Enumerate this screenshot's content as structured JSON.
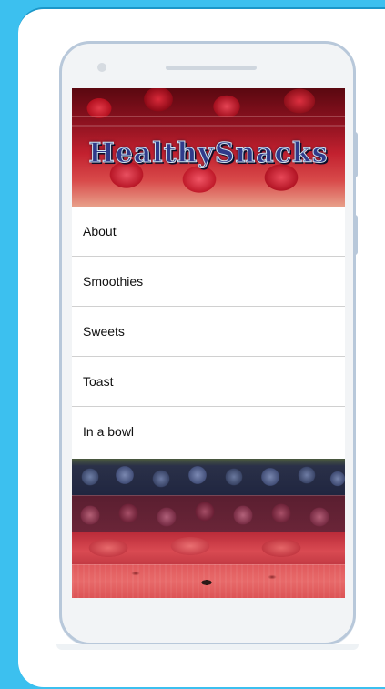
{
  "app": {
    "brand_title": "HealthySnacks"
  },
  "menu": {
    "items": [
      {
        "label": "About"
      },
      {
        "label": "Smoothies"
      },
      {
        "label": "Sweets"
      },
      {
        "label": "Toast"
      },
      {
        "label": "In a bowl"
      }
    ]
  },
  "colors": {
    "page_background": "#3cc0ef",
    "card_background": "#ffffff",
    "phone_frame": "#b8c8da",
    "banner_title": "#2f3a8a"
  },
  "images": {
    "header": "cherries-banner-image",
    "footer": "grapes-and-watermelon-image"
  }
}
